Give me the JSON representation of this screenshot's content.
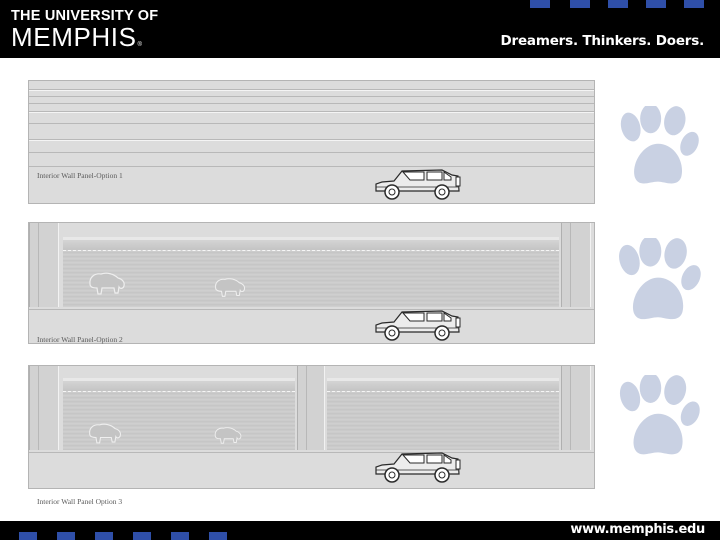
{
  "header": {
    "logo_line1": "THE UNIVERSITY OF",
    "logo_line2": "MEMPHIS",
    "logo_mark": "®",
    "tagline": "Dreamers. Thinkers. Doers."
  },
  "panels": [
    {
      "label": "Interior Wall Panel-Option 1"
    },
    {
      "label": "Interior Wall Panel-Option 2"
    },
    {
      "label": "Interior Wall Panel Option 3"
    }
  ],
  "footer": {
    "url": "www.memphis.edu"
  },
  "colors": {
    "header_bg": "#000000",
    "accent_blue": "#2f4fa8",
    "paw": "#c9d1e3",
    "panel_gray": "#dcdcdc"
  },
  "icons": {
    "paw": "paw-print-icon",
    "vehicle": "suv-vehicle-icon",
    "bison": "bison-icon"
  }
}
